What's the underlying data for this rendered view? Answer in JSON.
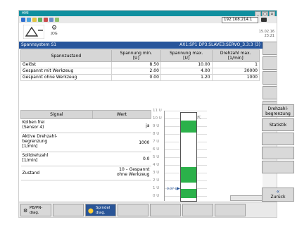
{
  "window": {
    "title": "HMI",
    "ip": "192.168.214.1"
  },
  "header": {
    "channel": "JOG",
    "date": "15.02.16",
    "time": "23:21"
  },
  "bluebar": {
    "left": "Spannsystem S1",
    "right": "AX1:SP1 DP3.SLAVE3:SERVO_3.3:3 (3)"
  },
  "table1": {
    "headers": [
      "Spannzustand",
      "Spannung min.\n[U]",
      "Spannung max.\n[U]",
      "Drehzahl max.\n[1/min]"
    ],
    "rows": [
      [
        "Gelöst",
        "8.50",
        "10.00",
        "1"
      ],
      [
        "Gespannt mit Werkzeug",
        "2.00",
        "4.00",
        "30000"
      ],
      [
        "Gespannt ohne Werkzeug",
        "0.00",
        "1.20",
        "1000"
      ]
    ]
  },
  "table2": {
    "headers": [
      "Signal",
      "Wert"
    ],
    "rows": [
      [
        "Kolben frei\n(Sensor 4)",
        "ja"
      ],
      [
        "Aktive Drehzahl-\nbegrenzung\n[1/min]",
        "1000"
      ],
      [
        "Solldrehzahl\n[1/min]",
        "0.0"
      ],
      [
        "Zustand",
        "10 – Gespannt\nohne Werkzeug"
      ]
    ]
  },
  "chart_data": {
    "type": "bar",
    "yticks": [
      "11 U",
      "10 U",
      "9 U",
      "8 U",
      "7 U",
      "6 U",
      "5 U",
      "4 U",
      "3 U",
      "2 U",
      "1 U",
      "0 U"
    ],
    "ylim": [
      0,
      11
    ],
    "bands": [
      [
        8.5,
        10.0
      ],
      [
        2.0,
        4.0
      ],
      [
        0.0,
        1.2
      ]
    ],
    "value_label": "0.07 U",
    "value": 0.07
  },
  "softkeys": {
    "drehzahl": "Drehzahl-\nbegrenzung",
    "statistik": "Statistik",
    "zurueck": "Zurück"
  },
  "bottom": {
    "pb": "PB/PN-\ndiag.",
    "spindel": "Spindel\ndiag."
  },
  "colors": {
    "titlebar": "#0f8f9f",
    "bluebar": "#27559b",
    "green": "#2bb14a"
  }
}
